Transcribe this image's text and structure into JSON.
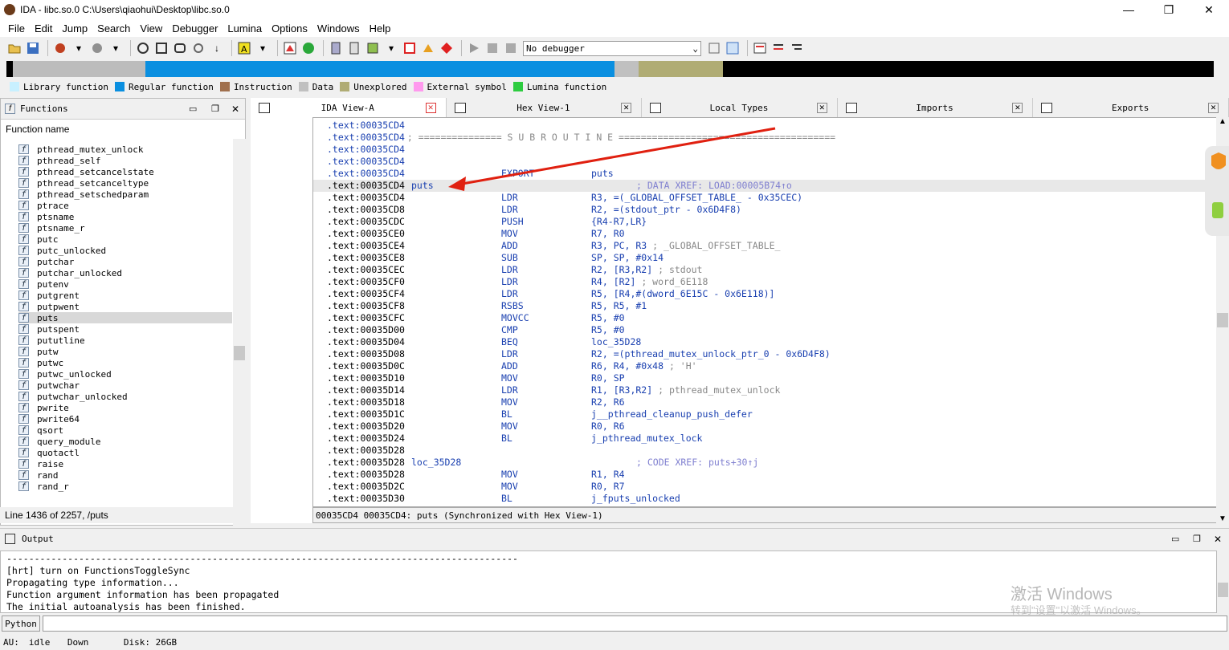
{
  "window": {
    "title": "IDA - libc.so.0 C:\\Users\\qiaohui\\Desktop\\libc.so.0",
    "minimize": "—",
    "maximize": "❐",
    "close": "✕"
  },
  "menu": [
    "File",
    "Edit",
    "Jump",
    "Search",
    "View",
    "Debugger",
    "Lumina",
    "Options",
    "Windows",
    "Help"
  ],
  "toolbar": {
    "debugger_select": "No debugger"
  },
  "legend": [
    {
      "label": "Library function",
      "color": "#c8f0ff"
    },
    {
      "label": "Regular function",
      "color": "#0a8fe0"
    },
    {
      "label": "Instruction",
      "color": "#a0704e"
    },
    {
      "label": "Data",
      "color": "#c0c0c0"
    },
    {
      "label": "Unexplored",
      "color": "#b0ac74"
    },
    {
      "label": "External symbol",
      "color": "#ff99ee"
    },
    {
      "label": "Lumina function",
      "color": "#2ecc40"
    }
  ],
  "functions_panel": {
    "title": "Functions",
    "column": "Function name",
    "items": [
      "pthread_mutex_unlock",
      "pthread_self",
      "pthread_setcancelstate",
      "pthread_setcanceltype",
      "pthread_setschedparam",
      "ptrace",
      "ptsname",
      "ptsname_r",
      "putc",
      "putc_unlocked",
      "putchar",
      "putchar_unlocked",
      "putenv",
      "putgrent",
      "putpwent",
      "puts",
      "putspent",
      "pututline",
      "putw",
      "putwc",
      "putwc_unlocked",
      "putwchar",
      "putwchar_unlocked",
      "pwrite",
      "pwrite64",
      "qsort",
      "query_module",
      "quotactl",
      "raise",
      "rand",
      "rand_r"
    ],
    "selected": "puts",
    "status": "Line 1436 of 2257, /puts"
  },
  "tabs": [
    {
      "label": "IDA View-A",
      "active": true
    },
    {
      "label": "Hex View-1",
      "active": false
    },
    {
      "label": "Local Types",
      "active": false
    },
    {
      "label": "Imports",
      "active": false
    },
    {
      "label": "Exports",
      "active": false
    }
  ],
  "listing": [
    {
      "addr": ".text:00035CD4"
    },
    {
      "addr": ".text:00035CD4",
      "comment": " ; =============== S U B R O U T I N E ======================================="
    },
    {
      "addr": ".text:00035CD4"
    },
    {
      "addr": ".text:00035CD4"
    },
    {
      "addr": ".text:00035CD4",
      "mn": "EXPORT",
      "op": "puts"
    },
    {
      "addr": ".text:00035CD4",
      "label": "puts",
      "xref": "; DATA XREF: LOAD:00005B74↑o"
    },
    {
      "addr": ".text:00035CD4",
      "mn": "LDR",
      "op": "R3, =(_GLOBAL_OFFSET_TABLE_ - 0x35CEC)"
    },
    {
      "addr": ".text:00035CD8",
      "mn": "LDR",
      "op": "R2, =(stdout_ptr - 0x6D4F8)"
    },
    {
      "addr": ".text:00035CDC",
      "mn": "PUSH",
      "op": "{R4-R7,LR}"
    },
    {
      "addr": ".text:00035CE0",
      "mn": "MOV",
      "op": "R7, R0"
    },
    {
      "addr": ".text:00035CE4",
      "mn": "ADD",
      "op": "R3, PC, R3",
      "cm": " ; _GLOBAL_OFFSET_TABLE_"
    },
    {
      "addr": ".text:00035CE8",
      "mn": "SUB",
      "op": "SP, SP, #0x14"
    },
    {
      "addr": ".text:00035CEC",
      "mn": "LDR",
      "op": "R2, [R3,R2]",
      "cm": " ; stdout"
    },
    {
      "addr": ".text:00035CF0",
      "mn": "LDR",
      "op": "R4, [R2]",
      "cm": " ; word_6E118"
    },
    {
      "addr": ".text:00035CF4",
      "mn": "LDR",
      "op": "R5, [R4,#(dword_6E15C - 0x6E118)]"
    },
    {
      "addr": ".text:00035CF8",
      "mn": "RSBS",
      "op": "R5, R5, #1"
    },
    {
      "addr": ".text:00035CFC",
      "mn": "MOVCC",
      "op": "R5, #0"
    },
    {
      "addr": ".text:00035D00",
      "mn": "CMP",
      "op": "R5, #0"
    },
    {
      "addr": ".text:00035D04",
      "mn": "BEQ",
      "op": "loc_35D28"
    },
    {
      "addr": ".text:00035D08",
      "mn": "LDR",
      "op": "R2, =(pthread_mutex_unlock_ptr_0 - 0x6D4F8)"
    },
    {
      "addr": ".text:00035D0C",
      "mn": "ADD",
      "op": "R6, R4, #0x48",
      "cm": " ; 'H'"
    },
    {
      "addr": ".text:00035D10",
      "mn": "MOV",
      "op": "R0, SP"
    },
    {
      "addr": ".text:00035D14",
      "mn": "LDR",
      "op": "R1, [R3,R2]",
      "cm": " ; pthread_mutex_unlock"
    },
    {
      "addr": ".text:00035D18",
      "mn": "MOV",
      "op": "R2, R6"
    },
    {
      "addr": ".text:00035D1C",
      "mn": "BL",
      "op": "j__pthread_cleanup_push_defer"
    },
    {
      "addr": ".text:00035D20",
      "mn": "MOV",
      "op": "R0, R6"
    },
    {
      "addr": ".text:00035D24",
      "mn": "BL",
      "op": "j_pthread_mutex_lock"
    },
    {
      "addr": ".text:00035D28"
    },
    {
      "addr": ".text:00035D28",
      "label": "loc_35D28",
      "xref": "; CODE XREF: puts+30↑j"
    },
    {
      "addr": ".text:00035D28",
      "mn": "MOV",
      "op": "R1, R4"
    },
    {
      "addr": ".text:00035D2C",
      "mn": "MOV",
      "op": "R0, R7"
    },
    {
      "addr": ".text:00035D30",
      "mn": "BL",
      "op": "j_fputs_unlocked"
    }
  ],
  "listing_status": "00035CD4 00035CD4: puts (Synchronized with Hex View-1)",
  "output_panel": {
    "title": "Output",
    "lines": [
      "--------------------------------------------------------------------------------------------",
      "[hrt] turn on FunctionsToggleSync",
      "Propagating type information...",
      "Function argument information has been propagated",
      "The initial autoanalysis has been finished."
    ]
  },
  "python_button": "Python",
  "statusbar": {
    "au": "AU:",
    "state": "idle",
    "dir": "Down",
    "disk": "Disk: 26GB"
  },
  "watermark": {
    "line1": "激活 Windows",
    "line2": "转到\"设置\"以激活 Windows。"
  }
}
